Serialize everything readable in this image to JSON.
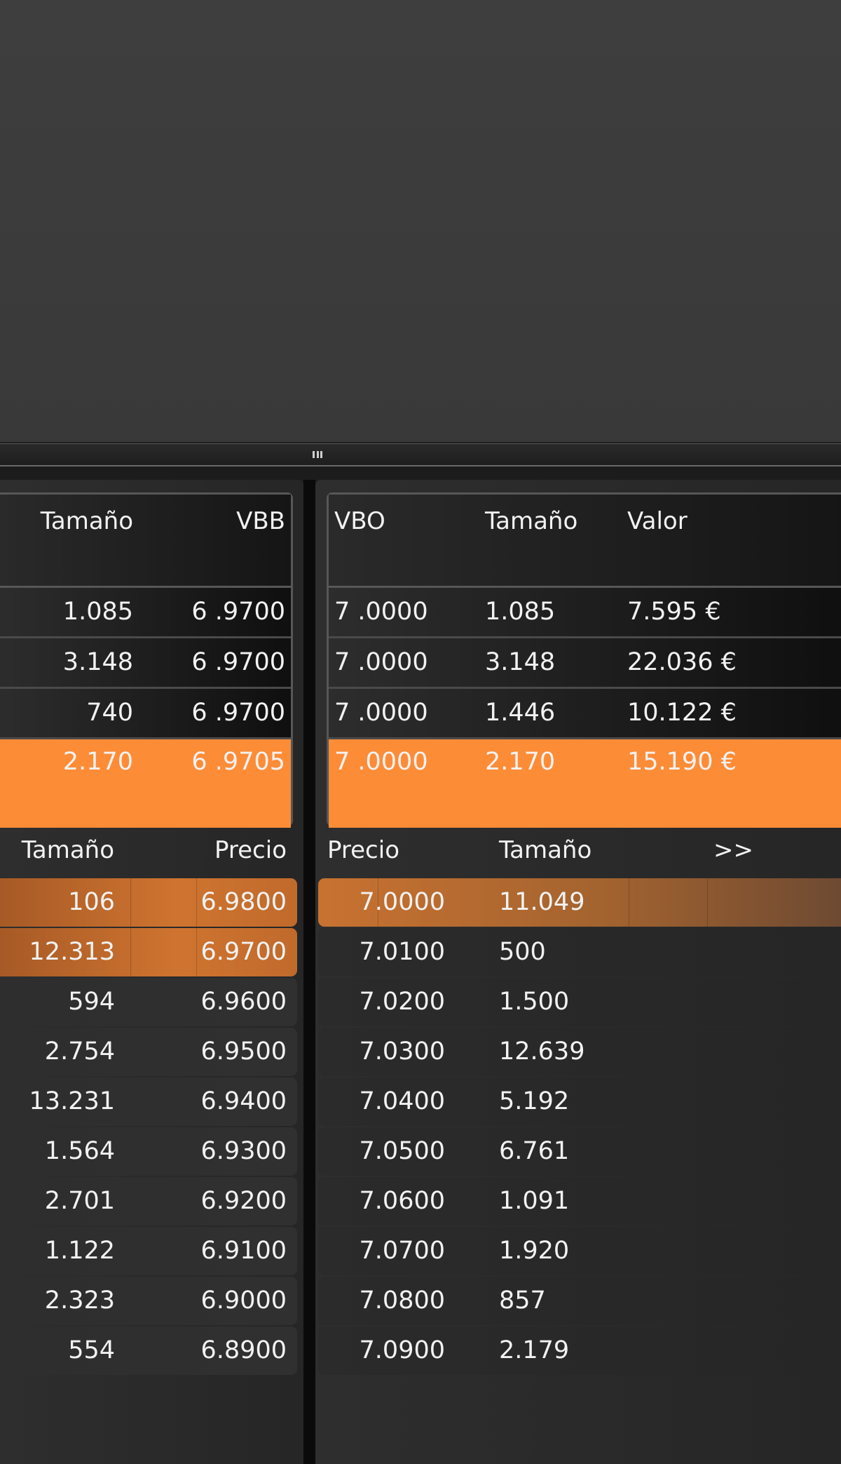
{
  "splitter": {
    "grip_icon": "drag-handle-icon"
  },
  "colors": {
    "accent_orange": "#fd8c37",
    "bid_highlight": "#cf7430",
    "ask_highlight": "#c87231"
  },
  "bid_trades": {
    "headers": {
      "size": "Tamaño",
      "price": "VBB"
    },
    "rows": [
      {
        "size": "1.085",
        "price": "6 .9700"
      },
      {
        "size": "3.148",
        "price": "6 .9700"
      },
      {
        "size": "740",
        "price": "6 .9700"
      },
      {
        "size": "2.170",
        "price": "6 .9705"
      }
    ]
  },
  "ask_trades": {
    "headers": {
      "price": "VBO",
      "size": "Tamaño",
      "value": "Valor"
    },
    "rows": [
      {
        "price": "7 .0000",
        "size": "1.085",
        "value": "7.595 €"
      },
      {
        "price": "7 .0000",
        "size": "3.148",
        "value": "22.036 €"
      },
      {
        "price": "7 .0000",
        "size": "1.446",
        "value": "10.122 €"
      },
      {
        "price": "7 .0000",
        "size": "2.170",
        "value": "15.190 €"
      }
    ]
  },
  "bid_depth": {
    "headers": {
      "size": "Tamaño",
      "price": "Precio"
    },
    "rows": [
      {
        "size": "106",
        "price": "6.9800"
      },
      {
        "size": "12.313",
        "price": "6.9700"
      },
      {
        "size": "594",
        "price": "6.9600"
      },
      {
        "size": "2.754",
        "price": "6.9500"
      },
      {
        "size": "13.231",
        "price": "6.9400"
      },
      {
        "size": "1.564",
        "price": "6.9300"
      },
      {
        "size": "2.701",
        "price": "6.9200"
      },
      {
        "size": "1.122",
        "price": "6.9100"
      },
      {
        "size": "2.323",
        "price": "6.9000"
      },
      {
        "size": "554",
        "price": "6.8900"
      }
    ]
  },
  "ask_depth": {
    "headers": {
      "price": "Precio",
      "size": "Tamaño",
      "more": ">>"
    },
    "rows": [
      {
        "price": "7.0000",
        "size": "11.049"
      },
      {
        "price": "7.0100",
        "size": "500"
      },
      {
        "price": "7.0200",
        "size": "1.500"
      },
      {
        "price": "7.0300",
        "size": "12.639"
      },
      {
        "price": "7.0400",
        "size": "5.192"
      },
      {
        "price": "7.0500",
        "size": "6.761"
      },
      {
        "price": "7.0600",
        "size": "1.091"
      },
      {
        "price": "7.0700",
        "size": "1.920"
      },
      {
        "price": "7.0800",
        "size": "857"
      },
      {
        "price": "7.0900",
        "size": "2.179"
      }
    ]
  }
}
